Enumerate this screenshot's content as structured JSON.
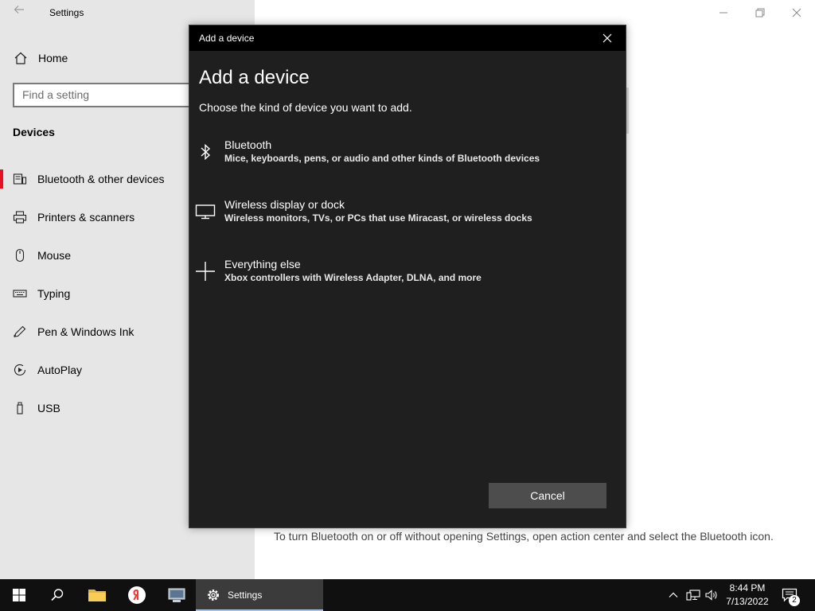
{
  "settings": {
    "window_title": "Settings",
    "home_label": "Home",
    "search_placeholder": "Find a setting",
    "section_title": "Devices",
    "nav_items": [
      {
        "label": "Bluetooth & other devices",
        "icon": "bluetooth-devices-icon",
        "selected": true
      },
      {
        "label": "Printers & scanners",
        "icon": "printer-icon"
      },
      {
        "label": "Mouse",
        "icon": "mouse-icon"
      },
      {
        "label": "Typing",
        "icon": "keyboard-icon"
      },
      {
        "label": "Pen & Windows Ink",
        "icon": "pen-icon"
      },
      {
        "label": "AutoPlay",
        "icon": "autoplay-icon"
      },
      {
        "label": "USB",
        "icon": "usb-icon"
      }
    ],
    "info_text": "To turn Bluetooth on or off without opening Settings, open action center and select the Bluetooth icon.",
    "accent_color": "#e81123"
  },
  "dialog": {
    "title": "Add a device",
    "heading": "Add a device",
    "subtitle": "Choose the kind of device you want to add.",
    "options": [
      {
        "name": "Bluetooth",
        "description": "Mice, keyboards, pens, or audio and other kinds of Bluetooth devices",
        "icon": "bluetooth-icon"
      },
      {
        "name": "Wireless display or dock",
        "description": "Wireless monitors, TVs, or PCs that use Miracast, or wireless docks",
        "icon": "monitor-icon"
      },
      {
        "name": "Everything else",
        "description": "Xbox controllers with Wireless Adapter, DLNA, and more",
        "icon": "plus-icon"
      }
    ],
    "cancel_label": "Cancel"
  },
  "taskbar": {
    "active_app_label": "Settings",
    "time": "8:44 PM",
    "date": "7/13/2022",
    "notification_count": "2"
  }
}
